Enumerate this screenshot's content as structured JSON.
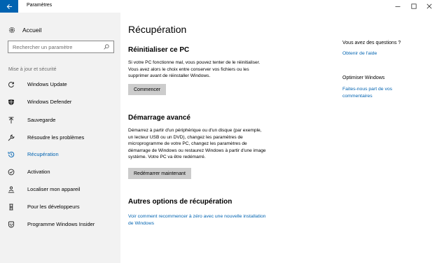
{
  "window": {
    "title": "Paramètres"
  },
  "sidebar": {
    "home_label": "Accueil",
    "search_placeholder": "Rechercher un paramètre",
    "section_label": "Mise à jour et sécurité",
    "items": [
      {
        "label": "Windows Update",
        "icon": "refresh-icon"
      },
      {
        "label": "Windows Defender",
        "icon": "shield-icon"
      },
      {
        "label": "Sauvegarde",
        "icon": "backup-icon"
      },
      {
        "label": "Résoudre les problèmes",
        "icon": "wrench-icon"
      },
      {
        "label": "Récupération",
        "icon": "history-icon",
        "active": true
      },
      {
        "label": "Activation",
        "icon": "check-circle-icon"
      },
      {
        "label": "Localiser mon appareil",
        "icon": "person-pin-icon"
      },
      {
        "label": "Pour les développeurs",
        "icon": "developer-icon"
      },
      {
        "label": "Programme Windows Insider",
        "icon": "insider-icon"
      }
    ]
  },
  "main": {
    "title": "Récupération",
    "reset": {
      "heading": "Réinitialiser ce PC",
      "text_lines": [
        "Si votre PC fonctionne mal, vous pouvez tenter de le réinitialiser.",
        "Vous avez alors le choix entre conserver vos fichiers ou les",
        "supprimer avant de réinstaller Windows."
      ],
      "button": "Commencer"
    },
    "advanced": {
      "heading": "Démarrage avancé",
      "text_lines": [
        "Démarrez à partir d'un périphérique ou d'un disque (par exemple,",
        "un lecteur USB ou un DVD), changez les paramètres de",
        "microprogramme de votre PC, changez les paramètres de",
        "démarrage de Windows ou restaurez Windows à partir d'une image",
        "système. Votre PC va être redémarré."
      ],
      "button": "Redémarrer maintenant"
    },
    "more": {
      "heading": "Autres options de récupération",
      "link_lines": [
        "Voir comment recommencer à zéro avec une nouvelle installation",
        "de Windows"
      ]
    }
  },
  "aside": {
    "questions_title": "Vous avez des questions ?",
    "help_link": "Obtenir de l'aide",
    "improve_title": "Optimiser Windows",
    "feedback_lines": [
      "Faites-nous part de vos",
      "commentaires"
    ]
  },
  "colors": {
    "accent": "#0063b1",
    "sidebar_bg": "#f2f2f2",
    "button_bg": "#cccccc"
  }
}
